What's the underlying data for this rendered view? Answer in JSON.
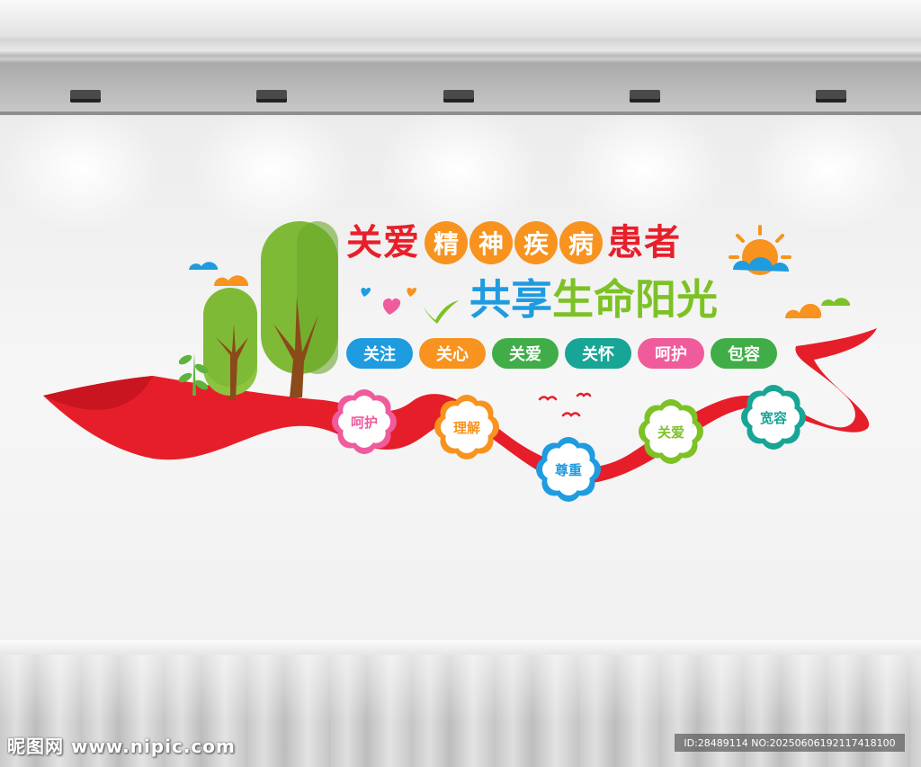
{
  "title_line1": {
    "part_a": "关爱",
    "dots": [
      "精",
      "神",
      "疾",
      "病"
    ],
    "part_b": "患者"
  },
  "title_line2": {
    "blue": "共享",
    "green": "生命阳光"
  },
  "pills": [
    {
      "label": "关注",
      "color": "#1f9be0"
    },
    {
      "label": "关心",
      "color": "#f7931e"
    },
    {
      "label": "关爱",
      "color": "#41ad49"
    },
    {
      "label": "关怀",
      "color": "#17a596"
    },
    {
      "label": "呵护",
      "color": "#f05b9c"
    },
    {
      "label": "包容",
      "color": "#41ad49"
    }
  ],
  "flowers": [
    {
      "label": "呵护",
      "color": "#f05b9c"
    },
    {
      "label": "理解",
      "color": "#f7931e"
    },
    {
      "label": "尊重",
      "color": "#1f9be0"
    },
    {
      "label": "关爱",
      "color": "#7dc225"
    },
    {
      "label": "宽容",
      "color": "#17a596"
    }
  ],
  "dot_colors": [
    "#f7931e",
    "#f7931e",
    "#f7931e",
    "#f7931e"
  ],
  "ribbon_color": "#e61e2a",
  "watermark": {
    "site": "昵图网 www.nipic.com",
    "id": "ID:28489114 NO:20250606192117418100"
  }
}
